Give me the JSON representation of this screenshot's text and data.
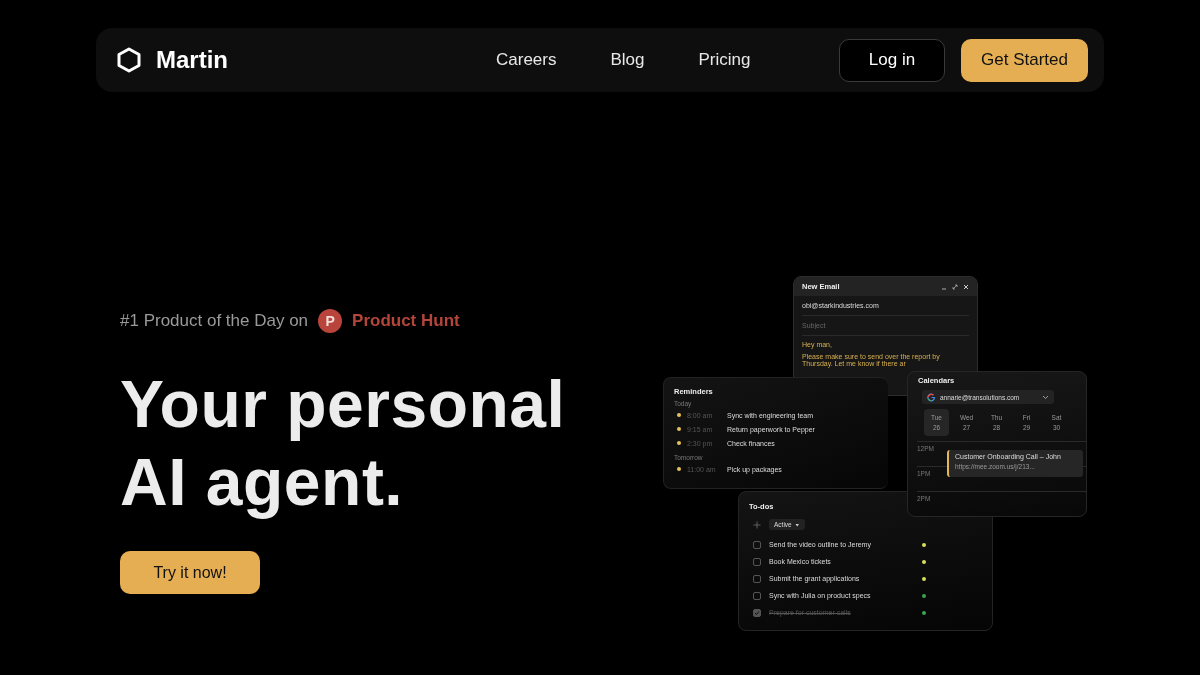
{
  "nav": {
    "brand": "Martin",
    "links": [
      {
        "label": "Careers"
      },
      {
        "label": "Blog"
      },
      {
        "label": "Pricing"
      }
    ],
    "login": "Log in",
    "cta": "Get Started"
  },
  "hero": {
    "badge_text": "#1 Product of the Day on",
    "badge_logo": "P",
    "badge_name": "Product Hunt",
    "headline_lines": [
      "Your personal",
      "AI agent."
    ],
    "button": "Try it now!"
  },
  "email": {
    "title": "New Email",
    "to": "obi@starkindustries.com",
    "subject": {
      "placeholder": "Subject"
    },
    "greeting": "Hey man,",
    "body_lines": [
      "Please make sure to send over the report by",
      "Thursday. Let me know if there ar"
    ]
  },
  "reminders": {
    "title": "Reminders",
    "groups": [
      {
        "label": "Today",
        "items": [
          {
            "time": "8:00 am",
            "text": "Sync with engineering team"
          },
          {
            "time": "9:15 am",
            "text": "Return paperwork to Pepper"
          },
          {
            "time": "2:30 pm",
            "text": "Check finances"
          }
        ]
      },
      {
        "label": "Tomorrow",
        "items": [
          {
            "time": "11:00 am",
            "text": "Pick up packages"
          }
        ]
      }
    ]
  },
  "calendar": {
    "title": "Calendars",
    "account": "annarie@transolutions.com",
    "days": [
      {
        "weekday": "Tue",
        "date": "26",
        "selected": true
      },
      {
        "weekday": "Wed",
        "date": "27",
        "selected": false
      },
      {
        "weekday": "Thu",
        "date": "28",
        "selected": false
      },
      {
        "weekday": "Fri",
        "date": "29",
        "selected": false
      },
      {
        "weekday": "Sat",
        "date": "30",
        "selected": false
      }
    ],
    "hours": [
      "12PM",
      "1PM",
      "2PM"
    ],
    "event": {
      "title": "Customer Onboarding Call – John",
      "link": "https://mee.zoom.us/j/213..."
    }
  },
  "todos": {
    "title": "To-dos",
    "filter": "Active",
    "items": [
      {
        "text": "Send the video outline to Jeremy",
        "checked": false,
        "color": "#d6de5c"
      },
      {
        "text": "Book Mexico tickets",
        "checked": false,
        "color": "#d6de5c"
      },
      {
        "text": "Submit the grant applications",
        "checked": false,
        "color": "#d6de5c"
      },
      {
        "text": "Sync with Julia on product specs",
        "checked": false,
        "color": "#3fa34d"
      },
      {
        "text": "Prepare for customer calls",
        "checked": true,
        "color": "#3fa34d"
      }
    ]
  }
}
